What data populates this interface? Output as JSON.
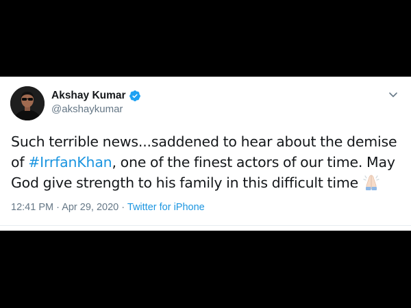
{
  "tweet": {
    "display_name": "Akshay Kumar",
    "handle": "@akshaykumar",
    "verified": true,
    "text_line1": "Such terrible news...saddened to hear about the demise",
    "text_line2_prefix": "of ",
    "hashtag": "#IrrfanKhan",
    "text_line2_suffix": ", one of the finest actors of our time. May",
    "text_line3": "God give strength to his family in this difficult time",
    "emoji": "folded-hands-icon",
    "time": "12:41 PM",
    "separator": "·",
    "date": "Apr 29, 2020",
    "source": "Twitter for iPhone"
  },
  "colors": {
    "background": "#000000",
    "card": "#ffffff",
    "text": "#14171a",
    "secondary": "#657786",
    "link": "#1b95e0",
    "verified": "#1da1f2"
  },
  "icons": {
    "avatar": "avatar",
    "verified": "verified-badge-icon",
    "caret": "chevron-down-icon"
  }
}
